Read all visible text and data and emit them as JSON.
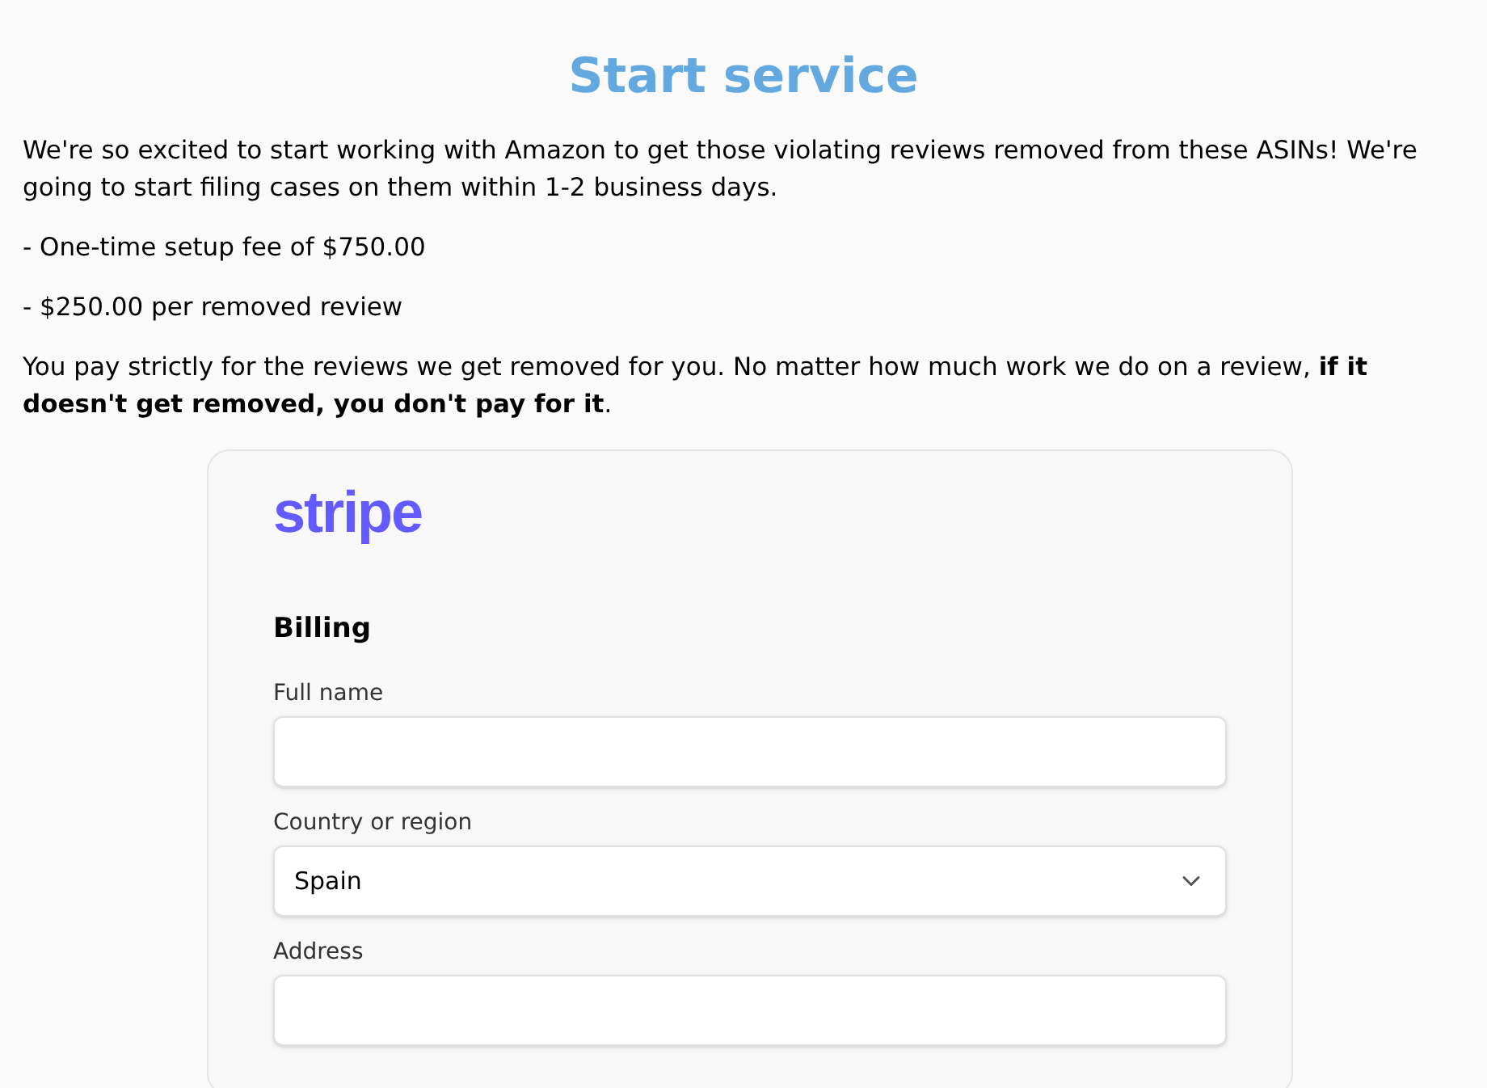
{
  "title": "Start service",
  "paragraphs": [
    "We're so excited to start working with Amazon to get those violating reviews removed from these ASINs! We're going to start filing cases on them within 1-2 business days.",
    "- One-time setup fee of $750.00",
    "- $250.00 per removed review",
    "You pay strictly for the reviews we get removed for you. No matter how much work we do on a review, **if it doesn't get removed, you don't pay for it**."
  ],
  "checkout": {
    "logo": "stripe",
    "section_title": "Billing",
    "fields": [
      {
        "kind": "text",
        "label": "Full name"
      },
      {
        "kind": "select",
        "label": "Country or region",
        "value": "Spain"
      },
      {
        "kind": "text",
        "label": "Address"
      }
    ]
  }
}
